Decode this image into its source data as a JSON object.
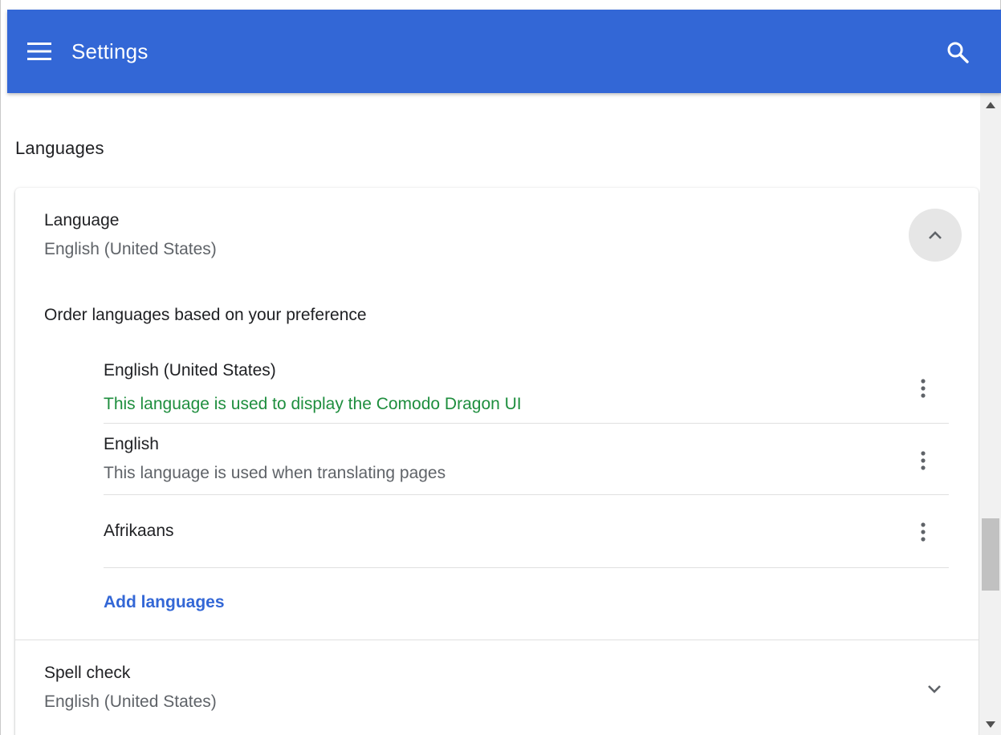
{
  "header": {
    "title": "Settings",
    "menu_icon": "hamburger-menu-icon",
    "search_icon": "search-icon",
    "background_color": "#3367d6"
  },
  "languages_section": {
    "heading": "Languages",
    "language": {
      "title": "Language",
      "current_value": "English (United States)",
      "collapse_icon": "chevron-up-icon",
      "order_label": "Order languages based on your preference",
      "items": [
        {
          "name": "English (United States)",
          "note": "This language is used to display the Comodo Dragon UI",
          "note_color": "#1e8e3e"
        },
        {
          "name": "English",
          "note": "This language is used when translating pages"
        },
        {
          "name": "Afrikaans",
          "note": ""
        }
      ],
      "more_icon": "more-vertical-icon",
      "add_label": "Add languages"
    },
    "spell_check": {
      "title": "Spell check",
      "current_value": "English (United States)",
      "expand_icon": "chevron-down-icon"
    }
  },
  "scrollbar": {
    "up_icon": "scroll-up-arrow-icon",
    "down_icon": "scroll-down-arrow-icon"
  }
}
